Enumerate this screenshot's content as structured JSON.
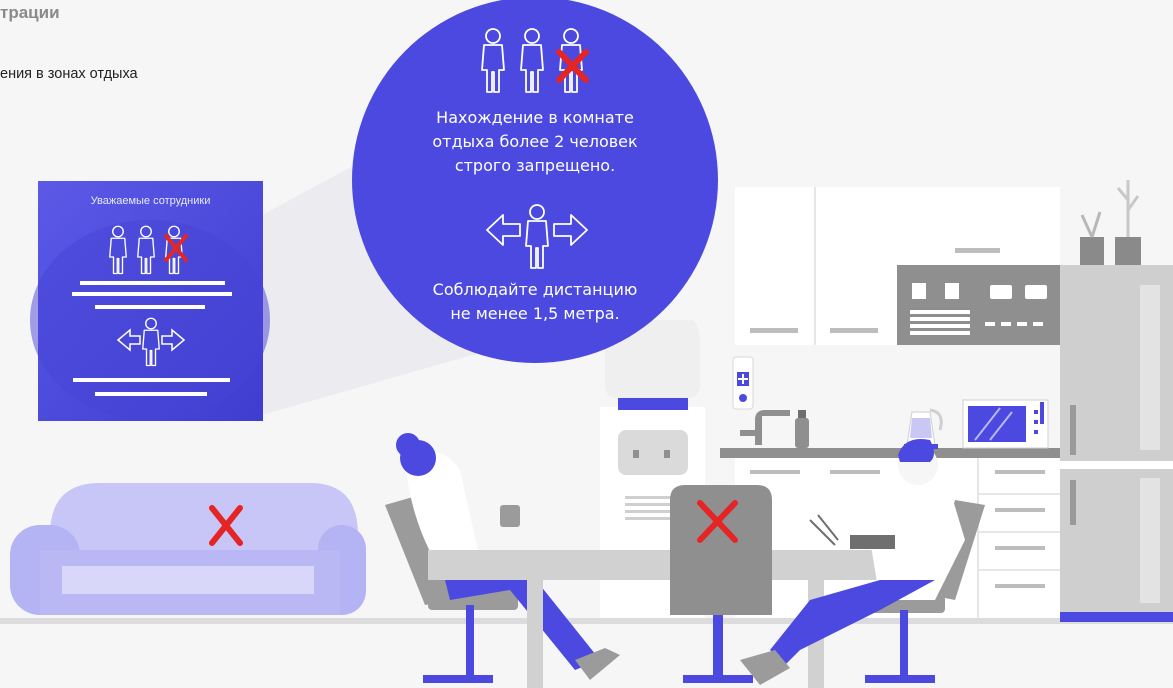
{
  "header": {
    "title": "трации",
    "subtitle": "ения в зонах отдыха"
  },
  "poster": {
    "title": "Уважаемые сотрудники"
  },
  "bubble": {
    "rule1_line1": "Нахождение в комнате",
    "rule1_line2": "отдыха более 2 человек",
    "rule1_line3": "строго запрещено.",
    "rule2_line1": "Соблюдайте дистанцию",
    "rule2_line2": "не менее 1,5 метра."
  },
  "colors": {
    "accent": "#4b49e0",
    "forbidden": "#e52525",
    "sofa": "#b9b8f5",
    "furniture_gray": "#9b9b9b",
    "background": "#f6f6f7"
  },
  "icons": [
    "person-icon",
    "forbidden-cross-icon",
    "distance-arrows-icon",
    "water-cooler-icon",
    "kettle-icon",
    "microwave-icon",
    "soap-dispenser-icon",
    "plant-icon"
  ]
}
